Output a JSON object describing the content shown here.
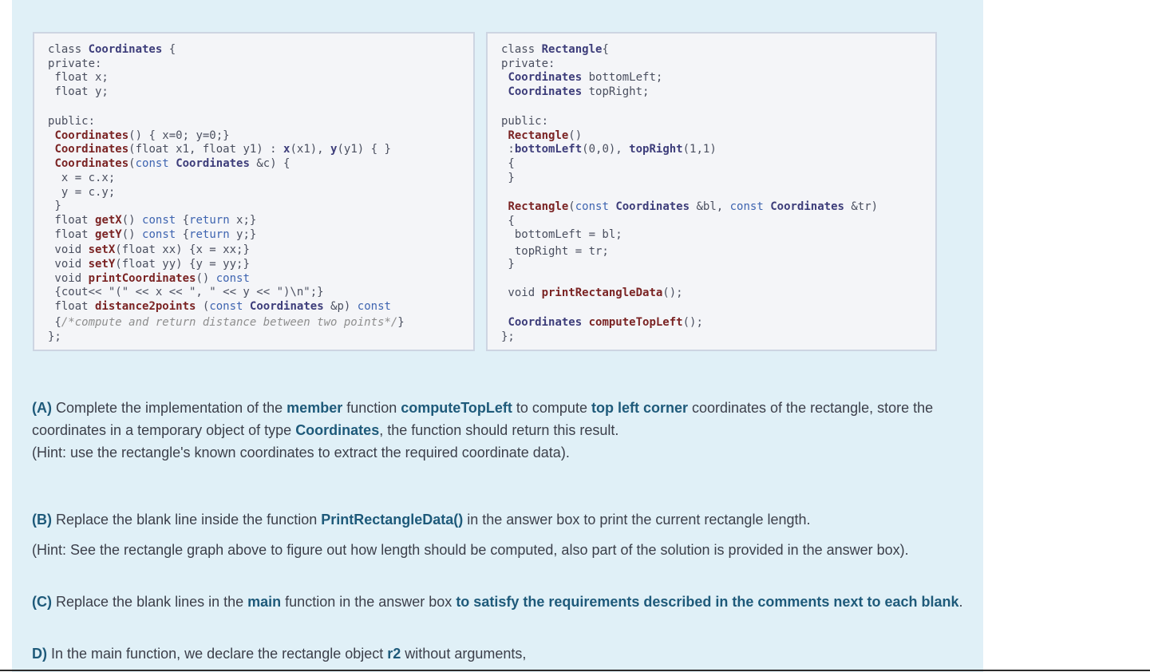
{
  "code_left": {
    "lines": [
      "class Coordinates {",
      "private:",
      " float x;",
      " float y;",
      "",
      "public:",
      " Coordinates() { x=0; y=0;}",
      " Coordinates(float x1, float y1) : x(x1), y(y1) { }",
      " Coordinates(const Coordinates &c) {",
      "  x = c.x;",
      "  y = c.y;",
      " }",
      " float getX() const {return x;}",
      " float getY() const {return y;}",
      " void setX(float xx) {x = xx;}",
      " void setY(float yy) {y = yy;}",
      " void printCoordinates() const",
      " {cout<< \"(\" << x << \", \" << y << \")\\n\";}",
      " float distance2points (const Coordinates &p) const",
      " {/*compute and return distance between two points*/}",
      "};"
    ]
  },
  "code_right": {
    "lines": [
      "class Rectangle{",
      "private:",
      " Coordinates bottomLeft;",
      " Coordinates topRight;",
      "",
      "public:",
      " Rectangle()",
      " :bottomLeft(0,0), topRight(1,1)",
      " {",
      " }",
      "",
      " Rectangle(const Coordinates &bl, const Coordinates &tr)",
      " {",
      "  bottomLeft = bl;",
      "  topRight = tr;",
      " }",
      "",
      " void printRectangleData();",
      "",
      " Coordinates computeTopLeft();",
      "};"
    ]
  },
  "questions": {
    "a_line1": "(A) Complete the implementation of the member function computeTopLeft to compute top left corner coordinates of the rectangle, store the",
    "a_line2": "coordinates in a temporary object of type Coordinates, the function should return this result.",
    "a_hint": "(Hint: use the rectangle's known coordinates to extract the required coordinate data).",
    "b_line1": "(B) Replace the blank line inside the function PrintRectangleData() in the answer box to print the current rectangle length.",
    "b_hint": "(Hint: See the rectangle graph above to figure out how length should be computed, also part of the solution is provided in the answer box).",
    "c_line1": "(C) Replace the blank lines in the main function in the answer box to satisfy the requirements described in the comments next to each blank.",
    "d_line1": "D) In the main function, we declare the rectangle object r2 without arguments,"
  }
}
